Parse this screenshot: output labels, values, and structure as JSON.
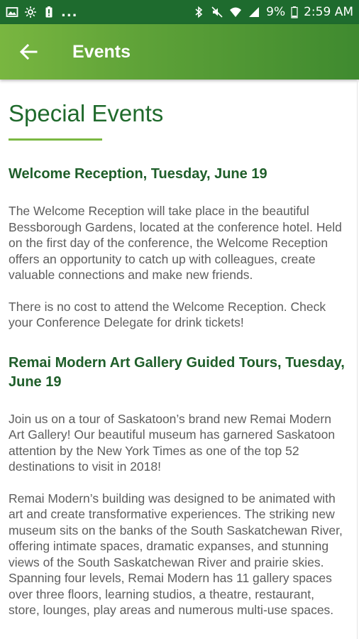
{
  "status_bar": {
    "left_icons": [
      "image-icon",
      "sync-icon",
      "battery-saver-icon"
    ],
    "dots": "...",
    "right_icons": [
      "bluetooth-icon",
      "mute-icon",
      "wifi-icon",
      "signal-icon"
    ],
    "battery_percent": "9%",
    "time": "2:59 AM"
  },
  "app_bar": {
    "title": "Events",
    "back_icon": "arrow-left-icon"
  },
  "page": {
    "title": "Special Events",
    "events": [
      {
        "heading": "Welcome Reception, Tuesday, June 19",
        "paragraphs": [
          "The Welcome Reception will take place in the beautiful Bessborough Gardens, located at the conference hotel. Held on the first day of the conference, the Welcome Reception offers an opportunity to catch up with colleagues, create valuable connections and make new friends.",
          "There is no cost to attend the Welcome Reception. Check your Conference Delegate for drink tickets!"
        ]
      },
      {
        "heading": "Remai Modern Art Gallery Guided Tours, Tuesday, June 19",
        "paragraphs": [
          "Join us on a tour of Saskatoon’s brand new Remai Modern Art Gallery! Our beautiful museum has garnered Saskatoon attention by the New York Times as one of the top 52 destinations to visit in 2018!",
          "Remai Modern’s building was designed to be animated with art and create transformative experiences. The striking new museum sits on the banks of the South Saskatchewan River, offering intimate spaces, dramatic expanses, and stunning views of the South Saskatchewan River and prairie skies. Spanning four levels, Remai Modern has 11 gallery spaces over three floors, learning studios, a theatre, restaurant, store, lounges, play areas and numerous multi-use spaces."
        ]
      }
    ]
  },
  "colors": {
    "status_bar": "#1e6b2e",
    "app_bar_start": "#79b640",
    "app_bar_end": "#3f8a2f",
    "heading": "#1f5e2a",
    "title": "#1f6a2c",
    "accent_rule": "#7bb843",
    "body_text": "#5d5d5d"
  }
}
